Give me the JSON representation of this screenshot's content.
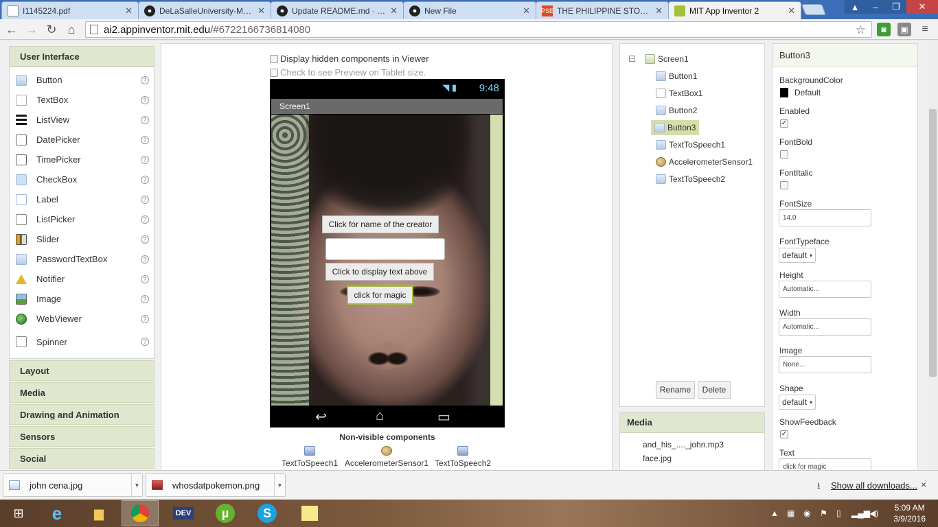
{
  "browser": {
    "tabs": [
      {
        "title": "I1145224.pdf",
        "icon": "document-icon"
      },
      {
        "title": "DeLaSalleUniversity-Manila",
        "icon": "github-icon"
      },
      {
        "title": "Update README.md · DeL",
        "icon": "github-icon"
      },
      {
        "title": "New File",
        "icon": "github-icon"
      },
      {
        "title": "THE PHILIPPINE STOCK EX",
        "icon": "pse-icon"
      },
      {
        "title": "MIT App Inventor 2",
        "icon": "appinventor-icon"
      }
    ],
    "url_host": "ai2.appinventor.mit.edu",
    "url_rest": "/#6722166736814080"
  },
  "palette": {
    "header": "User Interface",
    "items": [
      {
        "label": "Button",
        "icon": "button-icon"
      },
      {
        "label": "TextBox",
        "icon": "textbox-icon"
      },
      {
        "label": "ListView",
        "icon": "listview-icon"
      },
      {
        "label": "DatePicker",
        "icon": "datepicker-icon"
      },
      {
        "label": "TimePicker",
        "icon": "timepicker-icon"
      },
      {
        "label": "CheckBox",
        "icon": "checkbox-icon"
      },
      {
        "label": "Label",
        "icon": "label-icon"
      },
      {
        "label": "ListPicker",
        "icon": "listpicker-icon"
      },
      {
        "label": "Slider",
        "icon": "slider-icon"
      },
      {
        "label": "PasswordTextBox",
        "icon": "password-icon"
      },
      {
        "label": "Notifier",
        "icon": "notifier-icon"
      },
      {
        "label": "Image",
        "icon": "image-icon"
      },
      {
        "label": "WebViewer",
        "icon": "webviewer-icon"
      },
      {
        "label": "Spinner",
        "icon": "spinner-icon"
      }
    ],
    "help": "?",
    "categories": [
      "Layout",
      "Media",
      "Drawing and Animation",
      "Sensors",
      "Social"
    ]
  },
  "viewer": {
    "show_hidden": "Display hidden components in Viewer",
    "tablet_preview": "Check to see Preview on Tablet size.",
    "status_time": "9:48",
    "screen_title": "Screen1",
    "button1": "Click for name of the creator",
    "button2": "Click to display text above",
    "button3": "click for magic",
    "nonvisible_title": "Non-visible components",
    "nonvisible": [
      "TextToSpeech1",
      "AccelerometerSensor1",
      "TextToSpeech2"
    ]
  },
  "components": {
    "root": "Screen1",
    "toggle": "−",
    "items": [
      "Button1",
      "TextBox1",
      "Button2",
      "Button3",
      "TextToSpeech1",
      "AccelerometerSensor1",
      "TextToSpeech2"
    ],
    "selected": "Button3",
    "rename": "Rename",
    "delete": "Delete"
  },
  "media": {
    "header": "Media",
    "files": [
      "and_his_...._john.mp3",
      "face.jpg"
    ]
  },
  "properties": {
    "title": "Button3",
    "background_color_label": "BackgroundColor",
    "background_color_value": "Default",
    "background_color_swatch": "#000000",
    "enabled_label": "Enabled",
    "enabled": true,
    "fontbold_label": "FontBold",
    "fontbold": false,
    "fontitalic_label": "FontItalic",
    "fontitalic": false,
    "fontsize_label": "FontSize",
    "fontsize_value": "14.0",
    "fonttypeface_label": "FontTypeface",
    "fonttypeface_value": "default",
    "height_label": "Height",
    "height_value": "Automatic...",
    "width_label": "Width",
    "width_value": "Automatic...",
    "image_label": "Image",
    "image_value": "None...",
    "shape_label": "Shape",
    "shape_value": "default",
    "showfeedback_label": "ShowFeedback",
    "showfeedback": true,
    "text_label": "Text",
    "text_value": "click for magic"
  },
  "downloads": {
    "items": [
      {
        "name": "john cena.jpg"
      },
      {
        "name": "whosdatpokemon.png"
      }
    ],
    "show_all": "Show all downloads...",
    "close": "×"
  },
  "taskbar": {
    "time": "5:09 AM",
    "date": "3/9/2016"
  }
}
